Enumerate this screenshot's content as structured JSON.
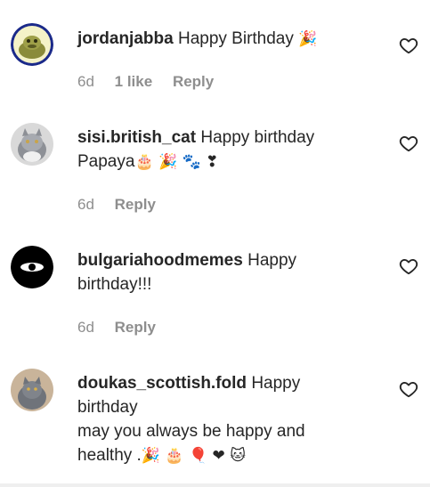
{
  "comments": [
    {
      "username": "jordanjabba",
      "text": "Happy Birthday",
      "emojis": "🎉",
      "time": "6d",
      "likes": "1 like",
      "reply": "Reply"
    },
    {
      "username": "sisi.british_cat",
      "text": "Happy birthday",
      "line2": "Papaya",
      "emojis": "🎂 🎉 🐾 ❣",
      "time": "6d",
      "reply": "Reply"
    },
    {
      "username": "bulgariahoodmemes",
      "text": "Happy",
      "line2": "birthday!!!",
      "time": "6d",
      "reply": "Reply"
    },
    {
      "username": "doukas_scottish.fold",
      "text": "Happy",
      "line2": "birthday",
      "line3": "may you always be happy and",
      "line4": "healthy .",
      "emojis": "🎉 🎂 🎈 ❤ 🐱"
    }
  ],
  "icons": {
    "like": "heart-outline-icon"
  },
  "colors": {
    "text": "#262626",
    "meta": "#8e8e8e",
    "heart_red": "#ed4956"
  }
}
